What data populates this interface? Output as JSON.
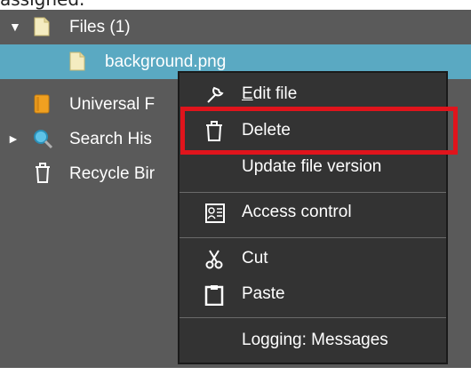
{
  "caption": "assigned.",
  "tree": {
    "items": [
      {
        "label": "Files (1)",
        "icon": "file-icon",
        "expanded": true
      },
      {
        "label": "background.png",
        "icon": "file-icon",
        "selected": true
      },
      {
        "label": "Universal F",
        "icon": "book-icon"
      },
      {
        "label": "Search His",
        "icon": "search-icon",
        "collapsed": true
      },
      {
        "label": "Recycle Bir",
        "icon": "trash-icon"
      }
    ]
  },
  "context_menu": {
    "items": [
      {
        "label_mnemonic": "E",
        "label_rest": "dit file",
        "icon": "wrench-icon"
      },
      {
        "label": "Delete",
        "icon": "trash-icon",
        "highlighted": true
      },
      {
        "label": "Update file version"
      },
      {
        "label": "Access control",
        "icon": "access-control-icon"
      },
      {
        "label": "Cut",
        "icon": "scissors-icon"
      },
      {
        "label": "Paste",
        "icon": "clipboard-icon"
      },
      {
        "label": "Logging: Messages"
      }
    ]
  },
  "colors": {
    "panel_bg": "#5a5a5a",
    "selection": "#5aa9c2",
    "menu_bg": "#333333",
    "annotation": "#e0141c"
  }
}
